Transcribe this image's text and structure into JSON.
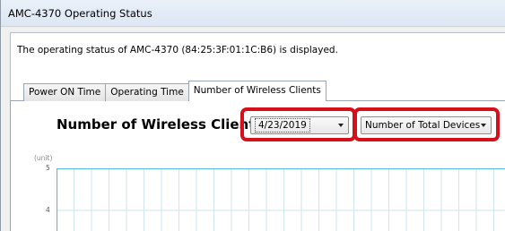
{
  "window": {
    "title": "AMC-4370 Operating Status"
  },
  "description": "The operating status of AMC-4370 (84:25:3F:01:1C:B6) is displayed.",
  "tabs": [
    {
      "label": "Power ON Time",
      "active": false
    },
    {
      "label": "Operating Time",
      "active": false
    },
    {
      "label": "Number of Wireless Clients",
      "active": true
    }
  ],
  "chart": {
    "title": "Number of Wireless Clients",
    "unit_label": "(unit)",
    "y_ticks": [
      "5",
      "4"
    ]
  },
  "controls": {
    "date_select": {
      "value": "4/23/2019"
    },
    "device_select": {
      "value": "Number of Total Devices"
    }
  },
  "colors": {
    "highlight": "#d5101b",
    "plot_border": "#5bb8dc",
    "grid": "#cfe6f2"
  }
}
